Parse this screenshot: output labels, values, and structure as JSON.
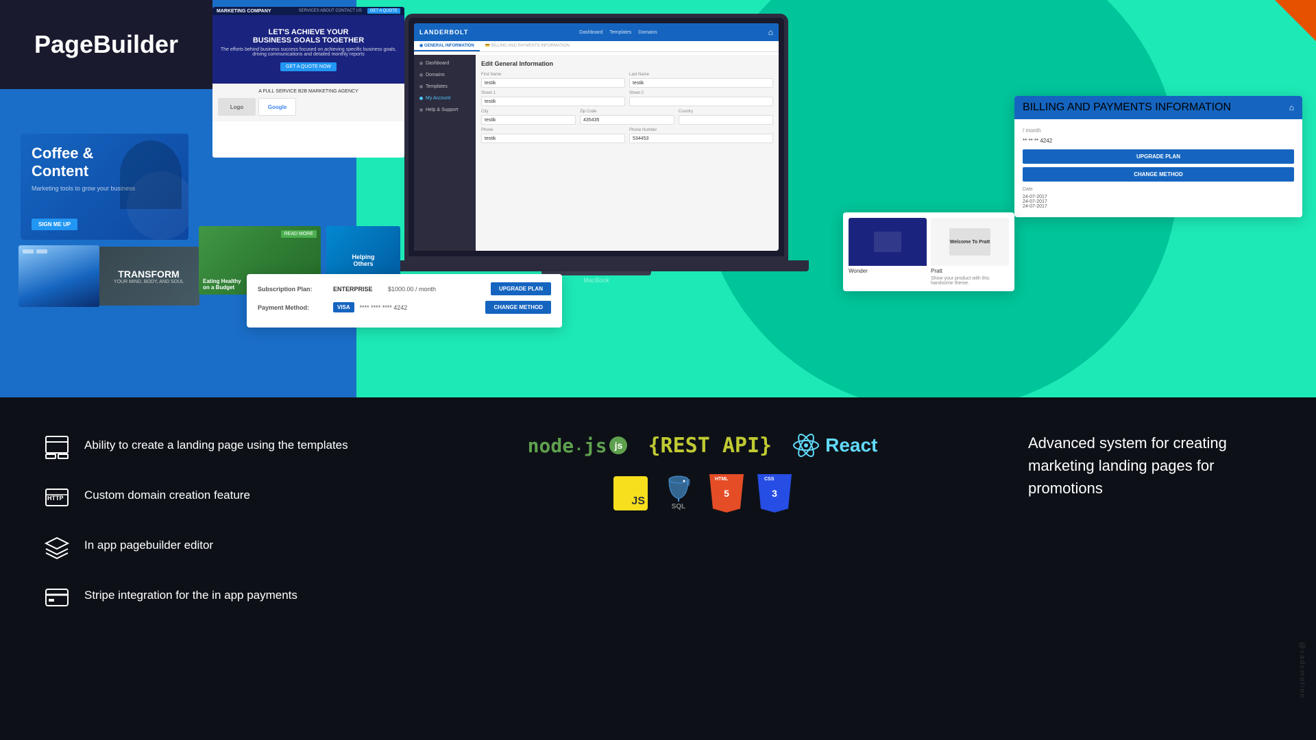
{
  "app": {
    "title": "PageBuilder",
    "corner_accent_color": "#e65100"
  },
  "top_section": {
    "bg_blue_color": "#1a6ec8",
    "bg_green_color": "#1de9b6",
    "coffee_card": {
      "title": "Coffee &\nContent",
      "subtitle": "Marketing tools to grow your business",
      "button_label": "SIGN ME UP"
    },
    "transform_banner": {
      "title": "TRANSFORM",
      "subtitle": "YOUR MIND, BODY, AND SOUL"
    },
    "laptop": {
      "brand": "LANDERBOLT",
      "sidebar_items": [
        "Dashboard",
        "Domains",
        "Templates",
        "My Account",
        "Help & Support"
      ],
      "active_item": "My Account",
      "form_title": "Edit General Information",
      "tabs": [
        "GENERAL INFORMATION",
        "BILLING AND PAYMENTS INFORMATION"
      ],
      "active_tab": "GENERAL INFORMATION",
      "fields": [
        {
          "label": "First Name",
          "value": "testik"
        },
        {
          "label": "Last Name",
          "value": "testik"
        },
        {
          "label": "Street 1",
          "value": "testik"
        },
        {
          "label": "Street 2",
          "value": ""
        },
        {
          "label": "City",
          "value": "testik"
        },
        {
          "label": "Zip Code",
          "value": "435435"
        },
        {
          "label": "Country",
          "value": ""
        },
        {
          "label": "Phone",
          "value": "testik"
        },
        {
          "label": "Phone Number",
          "value": "534453"
        }
      ],
      "brand_name": "MacBook"
    },
    "subscription_panel": {
      "plan_label": "Subscription Plan:",
      "plan_name": "ENTERPRISE",
      "plan_price": "$1000.00 / month",
      "upgrade_btn": "UPGRADE PLAN",
      "payment_label": "Payment Method:",
      "payment_type": "VISA",
      "card_number": "**** **** **** 4242",
      "change_btn": "CHANGE METHOD"
    },
    "billing_panel": {
      "title": "BILLING AND PAYMENTS INFORMATION",
      "per_month": "/ month",
      "card_dots": "** ** ** 4242",
      "upgrade_btn": "UPGRADE PLAN",
      "change_btn": "CHANGE METHOD",
      "date_label": "Date",
      "dates": [
        "24-07-2017",
        "24-07-2017",
        "24-07-2017"
      ]
    },
    "templates_panel": {
      "wonder_label": "Wonder",
      "pratt_label": "Pratt",
      "pratt_desc": "Show your product with this handsome theme."
    }
  },
  "bottom_section": {
    "features": [
      {
        "text": "Ability to create a landing page using the templates",
        "icon": "layout-icon"
      },
      {
        "text": "Custom domain creation feature",
        "icon": "http-icon"
      },
      {
        "text": "In app pagebuilder editor",
        "icon": "layers-icon"
      },
      {
        "text": "Stripe integration for the in app payments",
        "icon": "stripe-icon"
      }
    ],
    "tech_stack": {
      "row1": [
        "nodejs",
        "restapi",
        "react"
      ],
      "row2": [
        "javascript",
        "postgresql",
        "html5",
        "css3"
      ]
    },
    "right_text": "Advanced system for creating marketing landing pages for promotions",
    "watermark": "@cadcmotion"
  }
}
